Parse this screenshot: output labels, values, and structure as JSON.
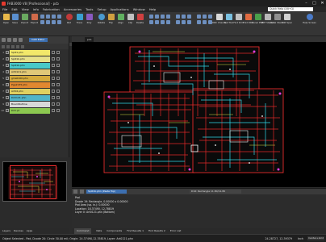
{
  "window": {
    "title": "FAB3000 V8 [Professional] - pcb"
  },
  "menu": [
    "File",
    "Edit",
    "View",
    "Info",
    "Fabrication",
    "Accessories",
    "Tools",
    "Setup",
    "Applications",
    "Window",
    "Help"
  ],
  "quick_help": "Quick Help (Alt+Q)",
  "ribbon": {
    "buttons": [
      "Open",
      "Save",
      "Import",
      "Export",
      "Pad",
      "Trace",
      "Poly",
      "Rotate",
      "Flip",
      "Align",
      "Clip",
      "Delete",
      "DRC Checks",
      "Net Tool",
      "Find Drill",
      "Fold DRC",
      "Panel PCB",
      "SMT Stencil",
      "Metal Stencil",
      "Drill Spec",
      "Help Screen"
    ],
    "groups": [
      "File",
      "Workspaces",
      "Create",
      "Modify",
      "Display",
      "Selection",
      "Utilities",
      "Featured Tools",
      "Help"
    ]
  },
  "left_panel": {
    "cam_editor_label": "CAM Editor",
    "layers": [
      {
        "num": "1",
        "name": "Spill1.phn",
        "color": "#f2e86a"
      },
      {
        "num": "2",
        "name": "Spill1b.phn",
        "color": "#e6e08a"
      },
      {
        "num": "3",
        "name": "Spill1b.phn",
        "color": "#48c8c8"
      },
      {
        "num": "4",
        "name": "Art0121.phn",
        "color": "#e0c878"
      },
      {
        "num": "5",
        "name": "gms0100.phn",
        "color": "#d4aa3c"
      },
      {
        "num": "6",
        "name": "Pgp2135.phn",
        "color": "#e08830"
      },
      {
        "num": "7",
        "name": "Art02.phn",
        "color": "#e0d060"
      },
      {
        "num": "8",
        "name": "Drill121.phn",
        "color": "#50b4c8"
      },
      {
        "num": "9",
        "name": "BoardOutline",
        "color": "#d8d8d8"
      },
      {
        "num": "10",
        "name": "Drill.pt",
        "color": "#8cc850"
      }
    ],
    "bottom_tabs": [
      "Layers",
      "Devices",
      "Apps"
    ]
  },
  "canvas": {
    "tab_label": "pcb"
  },
  "info_panel": {
    "layer_name": "Spill1b.phn (Paste Top)",
    "item_name": "D16: Rectangle 11.80/11.80",
    "lines": [
      "Pad",
      "Dcode 19: Rectangle, 0.00000 x 0.00000",
      "Pad Area (sq. in.): 0.00000",
      "Location: 18.37490, 12.78819",
      "Layer 0: Art0121.phn (Bottom)"
    ]
  },
  "bottom_tabs": [
    "Command",
    "Nets",
    "Components",
    "Find Results 1",
    "Find Results 2",
    "Error List"
  ],
  "status": {
    "message": "Object Selected - Pad, Dcode 20: Circle 30.00 mil; Origin: 24.37490,12.35819, Layer: Art0121.phn",
    "coords": "24.28727, 12.39379",
    "unit": "Inch",
    "snap": "Center+Grid"
  }
}
